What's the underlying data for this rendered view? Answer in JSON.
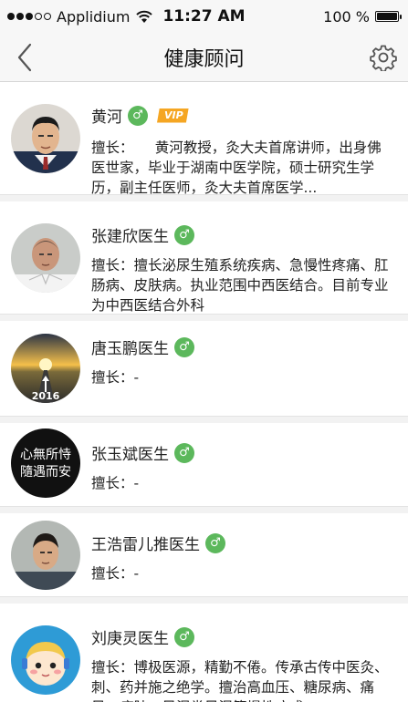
{
  "status_bar": {
    "carrier": "Applidium",
    "time": "11:27 AM",
    "battery_text": "100 %",
    "battery_level": 1.0,
    "signal_dots_filled": 3,
    "signal_dots_total": 5
  },
  "nav": {
    "title": "健康顾问",
    "back_icon": "chevron-left-icon",
    "settings_icon": "gear-icon"
  },
  "colors": {
    "male_badge": "#5cb85c",
    "vip_badge": "#f5a623",
    "divider": "#e3e3e3"
  },
  "doctors": [
    {
      "name": "黄河",
      "gender": "male",
      "gender_symbol": "♂",
      "vip": true,
      "vip_label": "VIP",
      "desc_label": "擅长：",
      "desc_text": "　　黄河教授，灸大夫首席讲师，出身佛医世家，毕业于湖南中医学院，硕士研究生学历，副主任医师，灸大夫首席医学..."
    },
    {
      "name": "张建欣医生",
      "gender": "male",
      "gender_symbol": "♂",
      "vip": false,
      "desc_label": "擅长：",
      "desc_text": "擅长泌尿生殖系统疾病、急慢性疼痛、肛肠病、皮肤病。执业范围中西医结合。目前专业为中西医结合外科"
    },
    {
      "name": "唐玉鹏医生",
      "gender": "male",
      "gender_symbol": "♂",
      "vip": false,
      "desc_label": "擅长：",
      "desc_text": "-",
      "avatar_caption": "2016"
    },
    {
      "name": "张玉斌医生",
      "gender": "male",
      "gender_symbol": "♂",
      "vip": false,
      "desc_label": "擅长：",
      "desc_text": "-",
      "avatar_caption": "心無所恃 隨遇而安"
    },
    {
      "name": "王浩雷儿推医生",
      "gender": "male",
      "gender_symbol": "♂",
      "vip": false,
      "desc_label": "擅长：",
      "desc_text": "-"
    },
    {
      "name": "刘庚灵医生",
      "gender": "male",
      "gender_symbol": "♂",
      "vip": false,
      "desc_label": "擅长：",
      "desc_text": "博极医源，精勤不倦。传承古传中医灸、刺、药并施之绝学。擅治高血压、糖尿病、痛风、癌肿、风湿类风湿等慢性病成..."
    }
  ]
}
